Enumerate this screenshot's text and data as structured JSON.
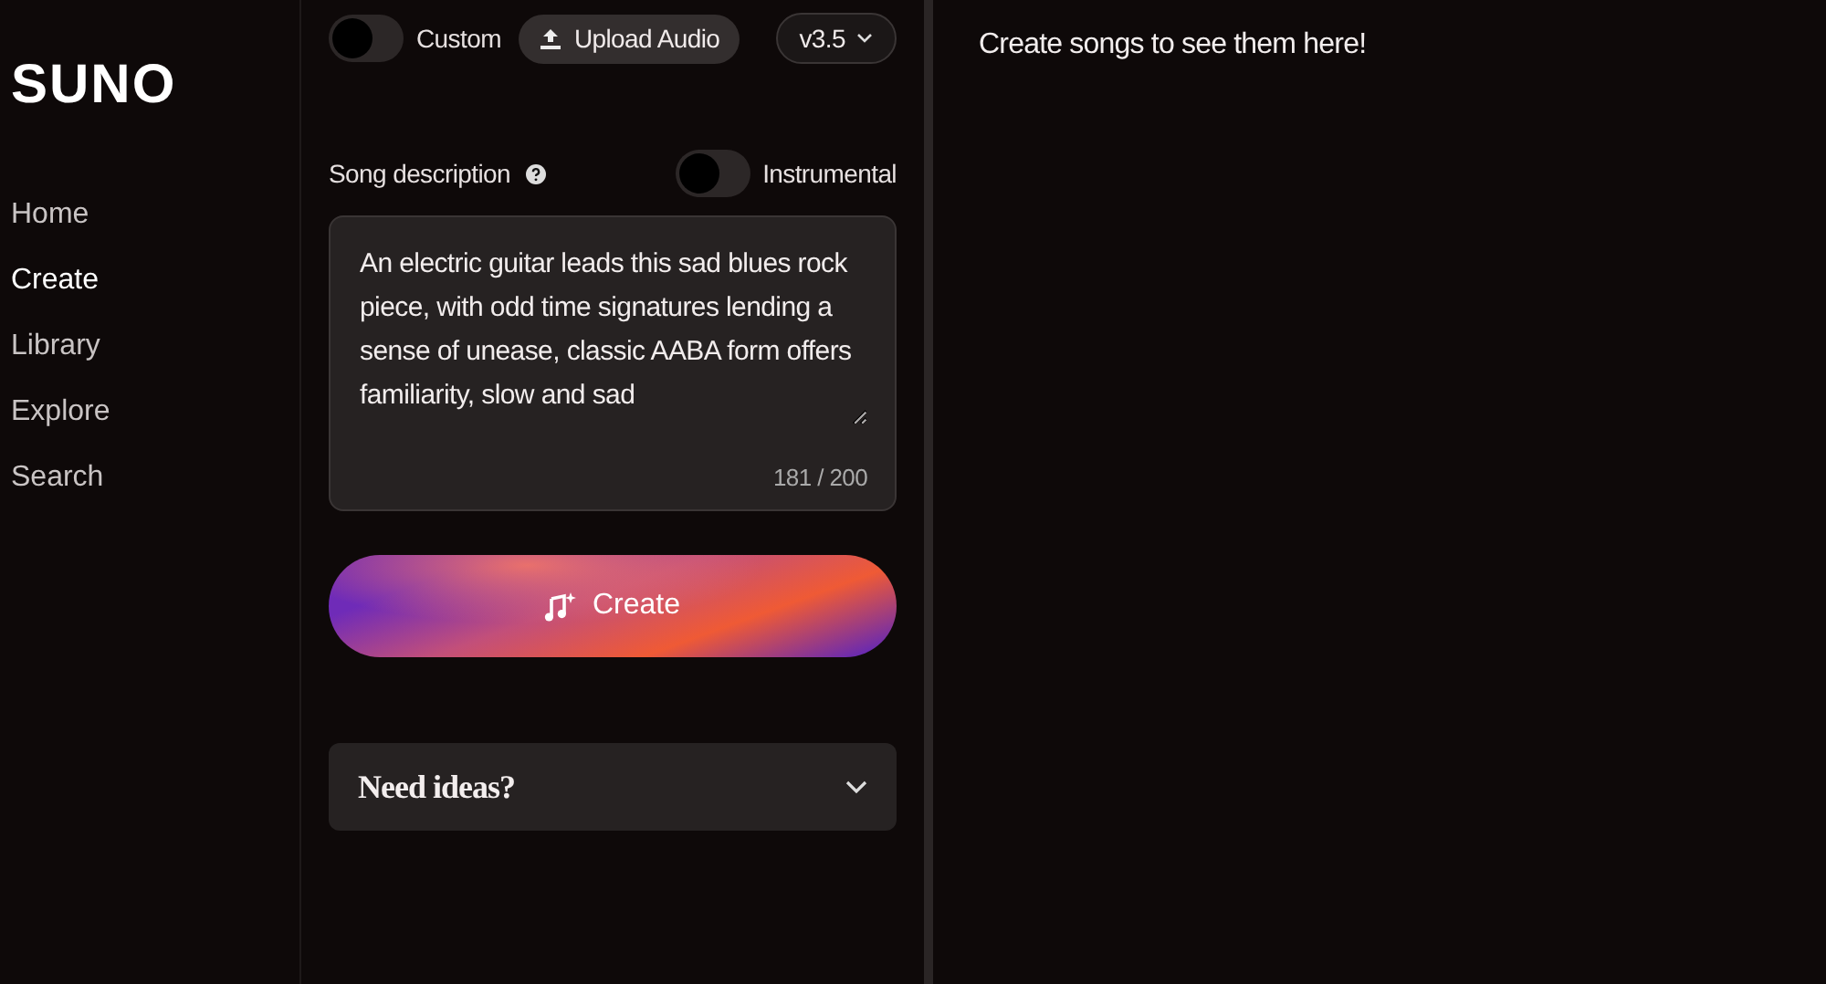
{
  "logo": "SUNO",
  "sidebar": {
    "items": [
      {
        "label": "Home",
        "selected": false
      },
      {
        "label": "Create",
        "selected": true
      },
      {
        "label": "Library",
        "selected": false
      },
      {
        "label": "Explore",
        "selected": false
      },
      {
        "label": "Search",
        "selected": false
      }
    ]
  },
  "create": {
    "custom_toggle": {
      "label": "Custom",
      "on": false
    },
    "upload_button": "Upload Audio",
    "version": "v3.5",
    "description_label": "Song description",
    "instrumental_toggle": {
      "label": "Instrumental",
      "on": false
    },
    "description": {
      "value": "An electric guitar leads this sad blues rock piece, with odd time signatures lending a sense of unease, classic AABA form offers familiarity, slow and sad",
      "counter": "181 / 200"
    },
    "create_button": "Create",
    "ideas": {
      "label": "Need ideas?",
      "expanded": false
    }
  },
  "songs_panel": {
    "empty_message": "Create songs to see them here!"
  }
}
